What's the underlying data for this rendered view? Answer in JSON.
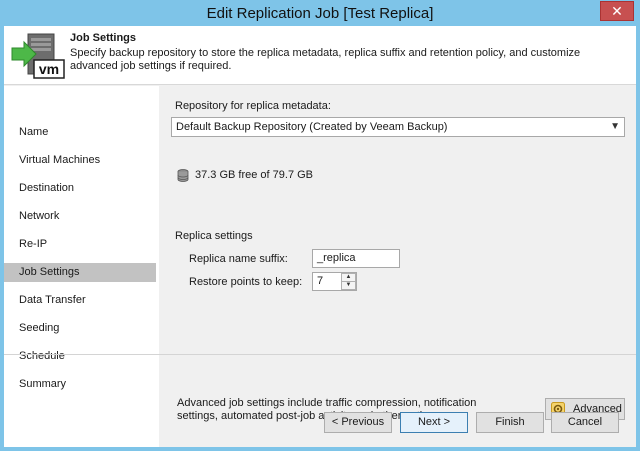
{
  "window": {
    "title": "Edit Replication Job [Test Replica]",
    "close_label": "✕"
  },
  "header": {
    "title": "Job Settings",
    "description": "Specify backup repository to store the replica metadata, replica suffix and retention policy, and customize advanced job settings if required.",
    "icon": "vm-server-icon",
    "icon_text": "vm"
  },
  "nav": {
    "items": [
      {
        "label": "Name"
      },
      {
        "label": "Virtual Machines"
      },
      {
        "label": "Destination"
      },
      {
        "label": "Network"
      },
      {
        "label": "Re-IP"
      },
      {
        "label": "Job Settings"
      },
      {
        "label": "Data Transfer"
      },
      {
        "label": "Seeding"
      },
      {
        "label": "Schedule"
      },
      {
        "label": "Summary"
      }
    ],
    "active_index": 5
  },
  "repository": {
    "label": "Repository for replica metadata:",
    "selected": "Default Backup Repository (Created by Veeam Backup)",
    "free_space": "37.3 GB free of 79.7 GB"
  },
  "replica_settings": {
    "group_label": "Replica settings",
    "suffix_label": "Replica name suffix:",
    "suffix_value": "_replica",
    "restore_points_label": "Restore points to keep:",
    "restore_points_value": "7"
  },
  "advanced": {
    "description": "Advanced job settings include traffic compression, notification settings, automated post-job activity and other options.",
    "button_label": "Advanced"
  },
  "footer": {
    "previous_label": "< Previous",
    "next_label": "Next >",
    "finish_label": "Finish",
    "cancel_label": "Cancel"
  },
  "colors": {
    "titlebar": "#7ec4e8",
    "close_button": "#c75050",
    "nav_active": "#c2c2c2",
    "primary_button_border": "#3c7fb1"
  }
}
